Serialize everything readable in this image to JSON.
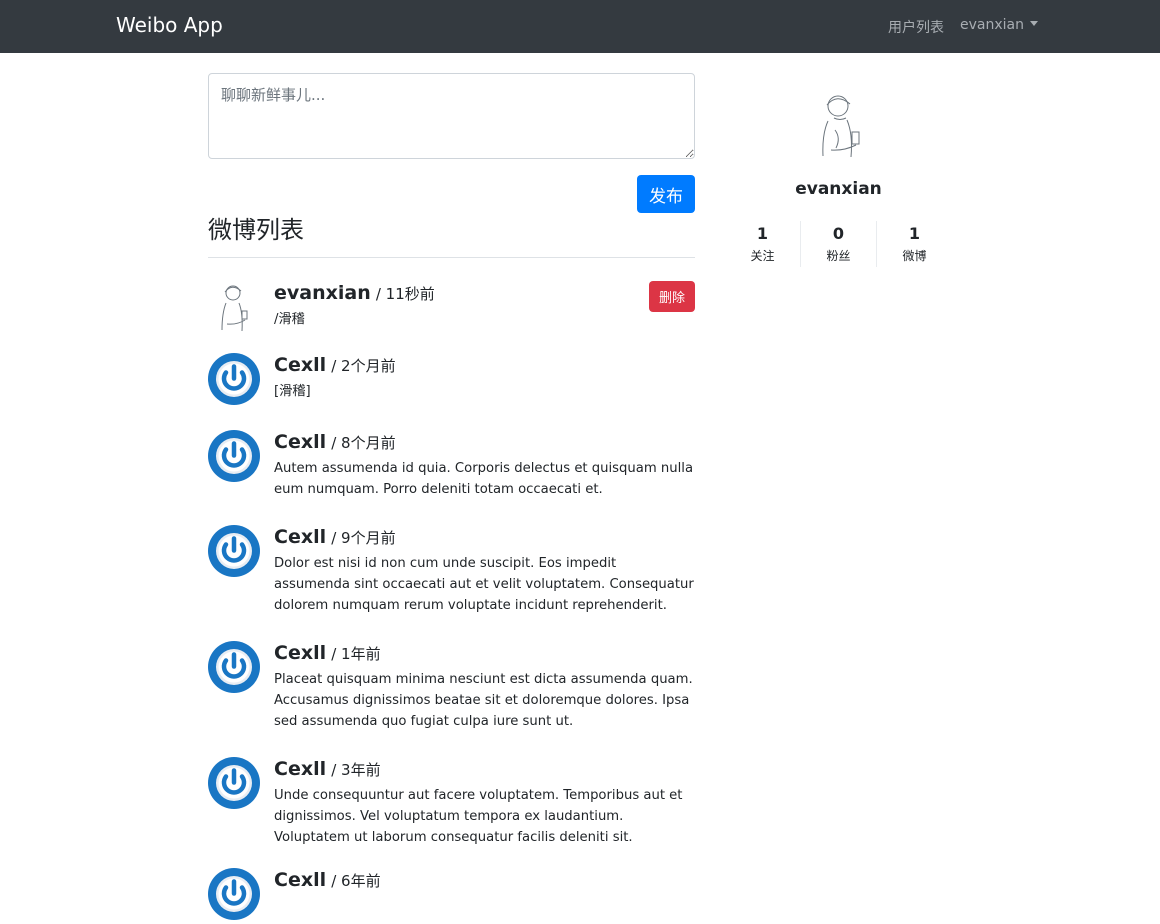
{
  "nav": {
    "brand": "Weibo App",
    "users_link": "用户列表",
    "user_menu": "evanxian"
  },
  "composer": {
    "placeholder": "聊聊新鲜事儿...",
    "submit_label": "发布"
  },
  "feed": {
    "title": "微博列表",
    "delete_label": "删除",
    "items": [
      {
        "author": "evanxian",
        "time": "/ 11秒前",
        "content": "/滑稽",
        "avatar": "sketch-avatar-icon"
      },
      {
        "author": "Cexll",
        "time": "/ 2个月前",
        "content": "[滑稽]",
        "avatar": "power-avatar-icon"
      },
      {
        "author": "Cexll",
        "time": "/ 8个月前",
        "content": "Autem assumenda id quia. Corporis delectus et quisquam nulla eum numquam. Porro deleniti totam occaecati et.",
        "avatar": "power-avatar-icon"
      },
      {
        "author": "Cexll",
        "time": "/ 9个月前",
        "content": "Dolor est nisi id non cum unde suscipit. Eos impedit assumenda sint occaecati aut et velit voluptatem. Consequatur dolorem numquam rerum voluptate incidunt reprehenderit.",
        "avatar": "power-avatar-icon"
      },
      {
        "author": "Cexll",
        "time": "/ 1年前",
        "content": "Placeat quisquam minima nesciunt est dicta assumenda quam. Accusamus dignissimos beatae sit et doloremque dolores. Ipsa sed assumenda quo fugiat culpa iure sunt ut.",
        "avatar": "power-avatar-icon"
      },
      {
        "author": "Cexll",
        "time": "/ 3年前",
        "content": "Unde consequuntur aut facere voluptatem. Temporibus aut et dignissimos. Vel voluptatum tempora ex laudantium. Voluptatem ut laborum consequatur facilis deleniti sit.",
        "avatar": "power-avatar-icon"
      },
      {
        "author": "Cexll",
        "time": "/ 6年前",
        "content": "",
        "avatar": "power-avatar-icon"
      }
    ]
  },
  "profile": {
    "name": "evanxian",
    "stats": [
      {
        "count": "1",
        "label": "关注"
      },
      {
        "count": "0",
        "label": "粉丝"
      },
      {
        "count": "1",
        "label": "微博"
      }
    ]
  },
  "colors": {
    "navbar": "#343a40",
    "primary": "#007bff",
    "danger": "#dc3545",
    "avatar_blue": "#1976c4"
  }
}
